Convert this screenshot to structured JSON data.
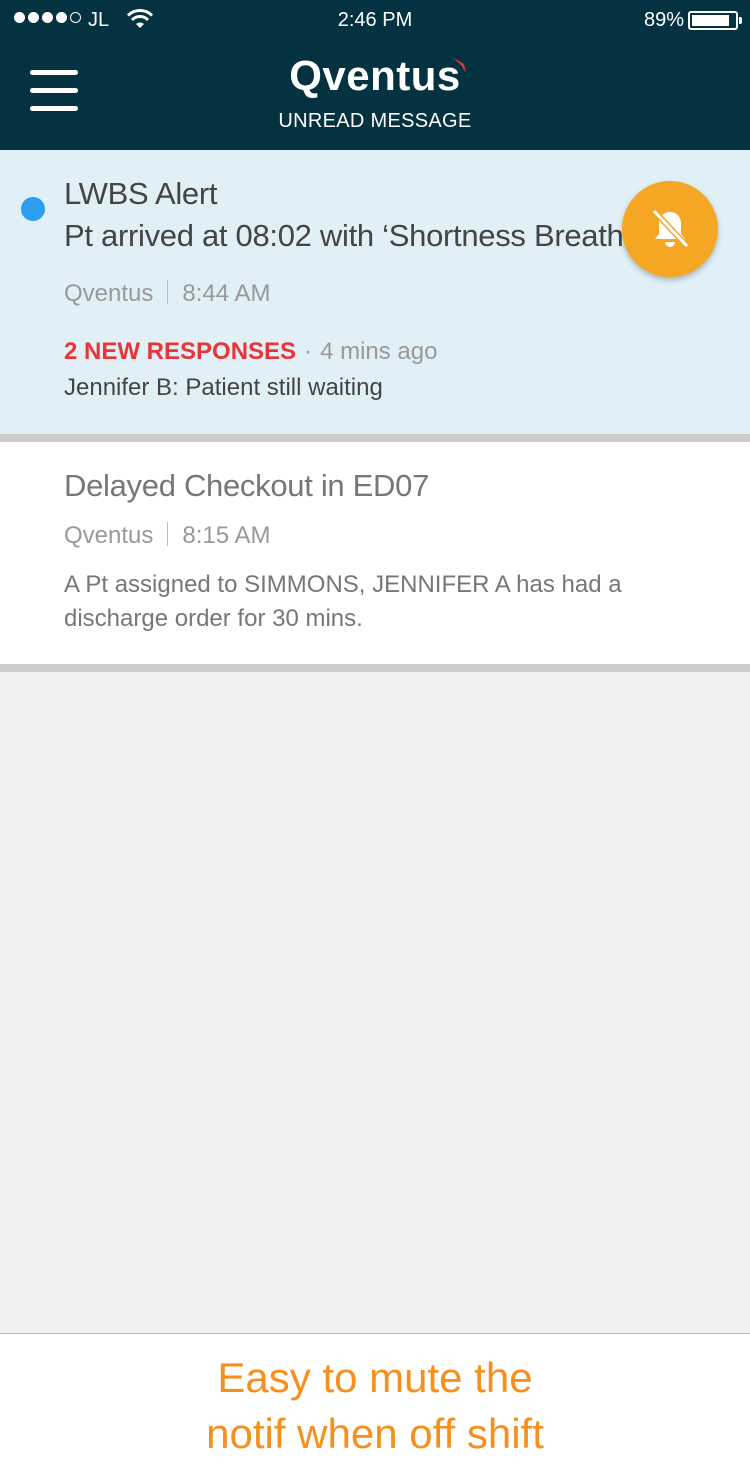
{
  "status_bar": {
    "carrier": "JL",
    "time": "2:46 PM",
    "battery_pct": "89%",
    "battery_level": 0.89,
    "signal_bars": 4,
    "signal_max": 5
  },
  "header": {
    "brand": "Qventus",
    "subtitle": "UNREAD MESSAGE",
    "menu_icon": "hamburger-menu-icon"
  },
  "messages": [
    {
      "title": "LWBS Alert",
      "line2": "Pt arrived at 08:02 with ‘Shortness Breath’",
      "source": "Qventus",
      "time": "8:44 AM",
      "unread": true,
      "responses_label": "2 NEW RESPONSES",
      "responses_sep": "·",
      "responses_ago": "4 mins ago",
      "latest_reply": "Jennifer B: Patient still waiting",
      "action_icon": "bell-muted-icon"
    },
    {
      "title": "Delayed Checkout in ED07",
      "source": "Qventus",
      "time": "8:15 AM",
      "body": "A Pt assigned to SIMMONS, JENNIFER A has had a discharge order for 30 mins."
    }
  ],
  "caption": {
    "line1": "Easy to mute the",
    "line2": "notif when off shift"
  },
  "colors": {
    "header_bg": "#043241",
    "unread_bg": "#e1f0f7",
    "unread_dot": "#2b9ef0",
    "mute_button": "#f5a623",
    "responses_red": "#ea3438",
    "caption_orange": "#f5901e"
  }
}
